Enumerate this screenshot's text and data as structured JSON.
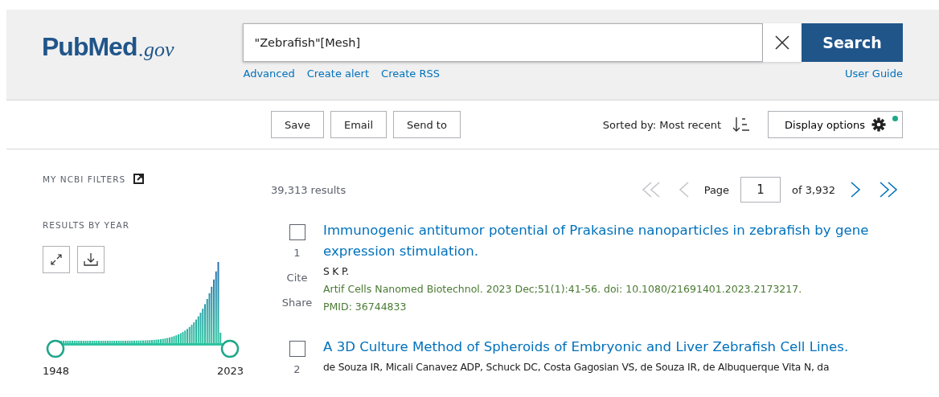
{
  "header": {
    "logo": {
      "main": "PubMed",
      "suffix": ".gov"
    },
    "search": {
      "value": "\"Zebrafish\"[Mesh]",
      "button": "Search"
    },
    "links": [
      "Advanced",
      "Create alert",
      "Create RSS"
    ],
    "user_guide": "User Guide"
  },
  "toolbar": {
    "buttons": [
      "Save",
      "Email",
      "Send to"
    ],
    "sort": "Sorted by: Most recent",
    "display_options": {
      "label": "Display options",
      "changed": true
    }
  },
  "sidebar": {
    "filters_title": "MY NCBI FILTERS",
    "year_title": "RESULTS BY YEAR",
    "year_range": {
      "start": "1948",
      "end": "2023",
      "thumbs": [
        {
          "level": 0
        },
        {
          "level": 1
        }
      ]
    }
  },
  "summary": {
    "count": "39,313 results"
  },
  "pagination": {
    "first_disabled": true,
    "prev_disabled": true,
    "label": "Page",
    "page": "1",
    "total": "of 3,932",
    "next_disabled": false,
    "last_disabled": false
  },
  "results": [
    {
      "checked": false,
      "number": "1",
      "actions": [
        "Cite",
        "Share"
      ],
      "title": "Immunogenic antitumor potential of Prakasine nanoparticles in zebrafish by gene expression stimulation.",
      "authors": "S K P.",
      "citation": "Artif Cells Nanomed Biotechnol. 2023 Dec;51(1):41-56. doi: 10.1080/21691401.2023.2173217.",
      "pmid": "PMID: 36744833"
    },
    {
      "checked": false,
      "number": "2",
      "title": "A 3D Culture Method of Spheroids of Embryonic and Liver Zebrafish Cell Lines.",
      "authors": "de Souza IR, Micali Canavez ADP, Schuck DC, Costa Gagosian VS, de Souza IR, de Albuquerque Vita N, da"
    }
  ]
}
